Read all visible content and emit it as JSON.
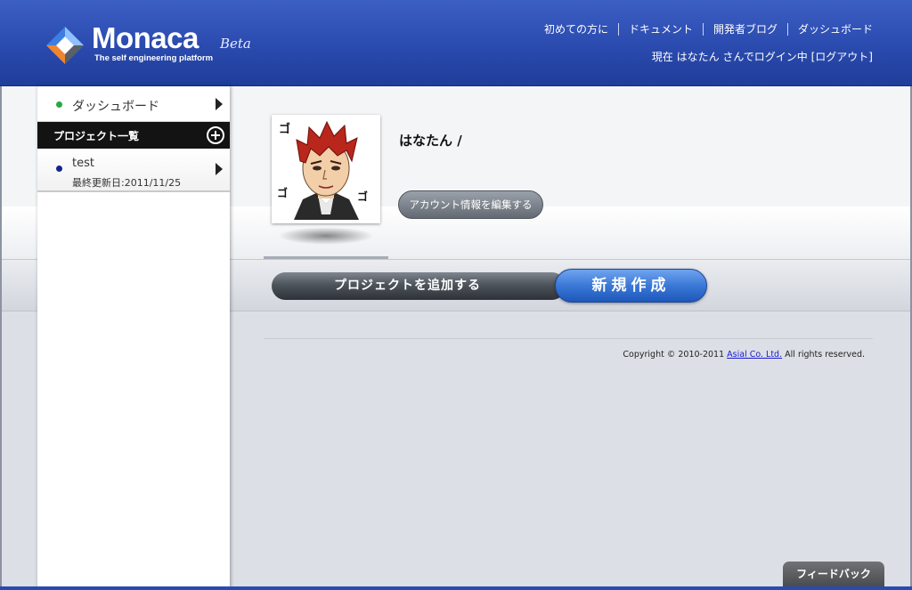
{
  "header": {
    "logo_text": "Monaca",
    "logo_beta": "Beta",
    "tagline": "The self engineering platform",
    "nav": [
      "初めての方に",
      "ドキュメント",
      "開発者ブログ",
      "ダッシュボード"
    ],
    "login_prefix": "現在 はなたん さんでログイン中 ",
    "logout_label": "[ログアウト]"
  },
  "sidebar": {
    "dashboard_label": "ダッシュボード",
    "projects_header": "プロジェクト一覧",
    "projects": [
      {
        "name": "test",
        "updated": "最終更新日:2011/11/25"
      }
    ]
  },
  "profile": {
    "username": "はなたん /",
    "edit_account_label": "アカウント情報を編集する"
  },
  "actions": {
    "add_project_label": "プロジェクトを追加する",
    "new_label": "新規作成"
  },
  "footer": {
    "copyright_prefix": "Copyright © 2010-2011 ",
    "company_link": "Asial Co. Ltd.",
    "copyright_suffix": " All rights reserved.",
    "feedback_label": "フィードバック"
  },
  "colors": {
    "header_blue": "#2a4aae",
    "new_button_blue": "#3b78d6",
    "dashboard_dot": "#27a844",
    "project_dot": "#15238e"
  }
}
